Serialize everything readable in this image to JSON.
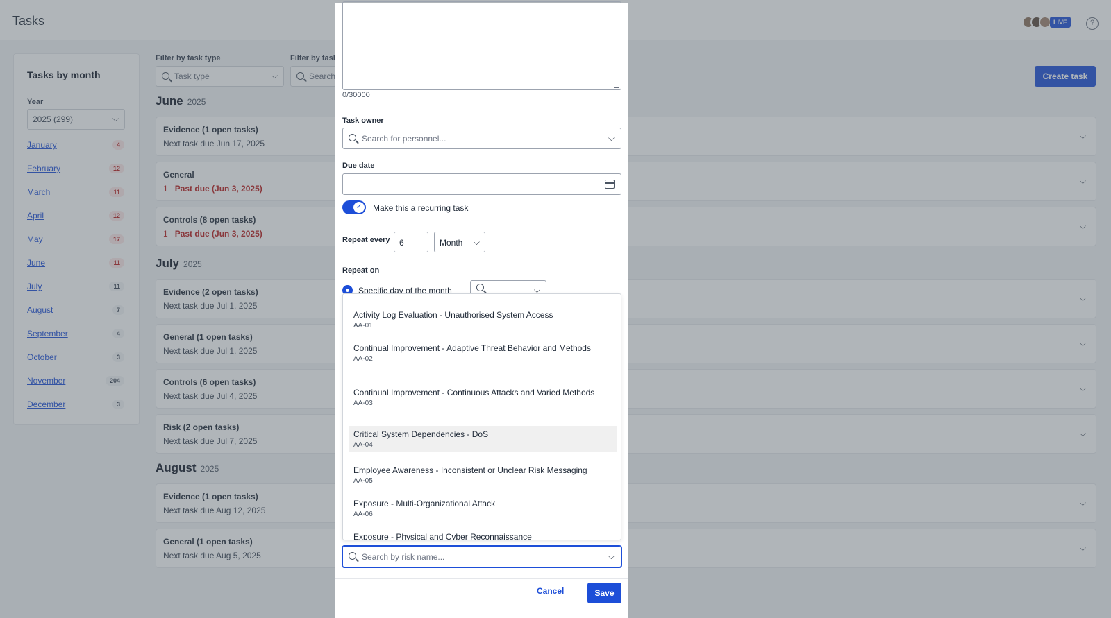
{
  "app": {
    "title": "Tasks",
    "live_badge": "LIVE",
    "help_icon": "?"
  },
  "sidebar": {
    "title": "Tasks by month",
    "year_label": "Year",
    "year_value": "2025 (299)",
    "months": [
      {
        "label": "January",
        "count": "4",
        "overdue": true
      },
      {
        "label": "February",
        "count": "12",
        "overdue": true
      },
      {
        "label": "March",
        "count": "11",
        "overdue": true
      },
      {
        "label": "April",
        "count": "12",
        "overdue": true
      },
      {
        "label": "May",
        "count": "17",
        "overdue": true
      },
      {
        "label": "June",
        "count": "11",
        "overdue": true
      },
      {
        "label": "July",
        "count": "11",
        "overdue": false
      },
      {
        "label": "August",
        "count": "7",
        "overdue": false
      },
      {
        "label": "September",
        "count": "4",
        "overdue": false
      },
      {
        "label": "October",
        "count": "3",
        "overdue": false
      },
      {
        "label": "November",
        "count": "204",
        "overdue": false
      },
      {
        "label": "December",
        "count": "3",
        "overdue": false
      }
    ]
  },
  "filters": {
    "type_label": "Filter by task type",
    "type_placeholder": "Task type",
    "name_label": "Filter by task",
    "name_placeholder": "Search"
  },
  "create_button": "Create task",
  "groups": [
    {
      "month": "June",
      "year": "2025",
      "cards": [
        {
          "title": "Evidence (1 open tasks)",
          "sub": "Next task due Jun 17, 2025",
          "past_due": false,
          "badge": ""
        },
        {
          "title": "General",
          "sub": "Past due (Jun 3, 2025)",
          "past_due": true,
          "badge": "1"
        },
        {
          "title": "Controls (8 open tasks)",
          "sub": "Past due (Jun 3, 2025)",
          "past_due": true,
          "badge": "1"
        }
      ]
    },
    {
      "month": "July",
      "year": "2025",
      "cards": [
        {
          "title": "Evidence (2 open tasks)",
          "sub": "Next task due Jul 1, 2025",
          "past_due": false,
          "badge": ""
        },
        {
          "title": "General (1 open tasks)",
          "sub": "Next task due Jul 1, 2025",
          "past_due": false,
          "badge": ""
        },
        {
          "title": "Controls (6 open tasks)",
          "sub": "Next task due Jul 4, 2025",
          "past_due": false,
          "badge": ""
        },
        {
          "title": "Risk (2 open tasks)",
          "sub": "Next task due Jul 7, 2025",
          "past_due": false,
          "badge": ""
        }
      ]
    },
    {
      "month": "August",
      "year": "2025",
      "cards": [
        {
          "title": "Evidence (1 open tasks)",
          "sub": "Next task due Aug 12, 2025",
          "past_due": false,
          "badge": ""
        },
        {
          "title": "General (1 open tasks)",
          "sub": "Next task due Aug 5, 2025",
          "past_due": false,
          "badge": ""
        }
      ]
    }
  ],
  "modal": {
    "char_count": "0/30000",
    "owner_label": "Task owner",
    "owner_placeholder": "Search for personnel...",
    "due_label": "Due date",
    "recurring_label": "Make this a recurring task",
    "repeat_every_label": "Repeat every",
    "repeat_every_value": "6",
    "repeat_unit": "Month",
    "repeat_on_label": "Repeat on",
    "radio_label": "Specific day of the month",
    "risk_placeholder": "Search by risk name...",
    "risk_options": [
      {
        "name": "Activity Log Evaluation - Unauthorised System Access",
        "code": "AA-01"
      },
      {
        "name": "Continual Improvement - Adaptive Threat Behavior and Methods",
        "code": "AA-02"
      },
      {
        "name": "Continual Improvement - Continuous Attacks and Varied Methods",
        "code": "AA-03"
      },
      {
        "name": "Critical System Dependencies - DoS",
        "code": "AA-04",
        "highlighted": true
      },
      {
        "name": "Employee Awareness - Inconsistent or Unclear Risk Messaging",
        "code": "AA-05"
      },
      {
        "name": "Exposure - Multi-Organizational Attack",
        "code": "AA-06"
      },
      {
        "name": "Exposure - Physical and Cyber Reconnaissance",
        "code": ""
      }
    ],
    "cancel": "Cancel",
    "save": "Save"
  }
}
